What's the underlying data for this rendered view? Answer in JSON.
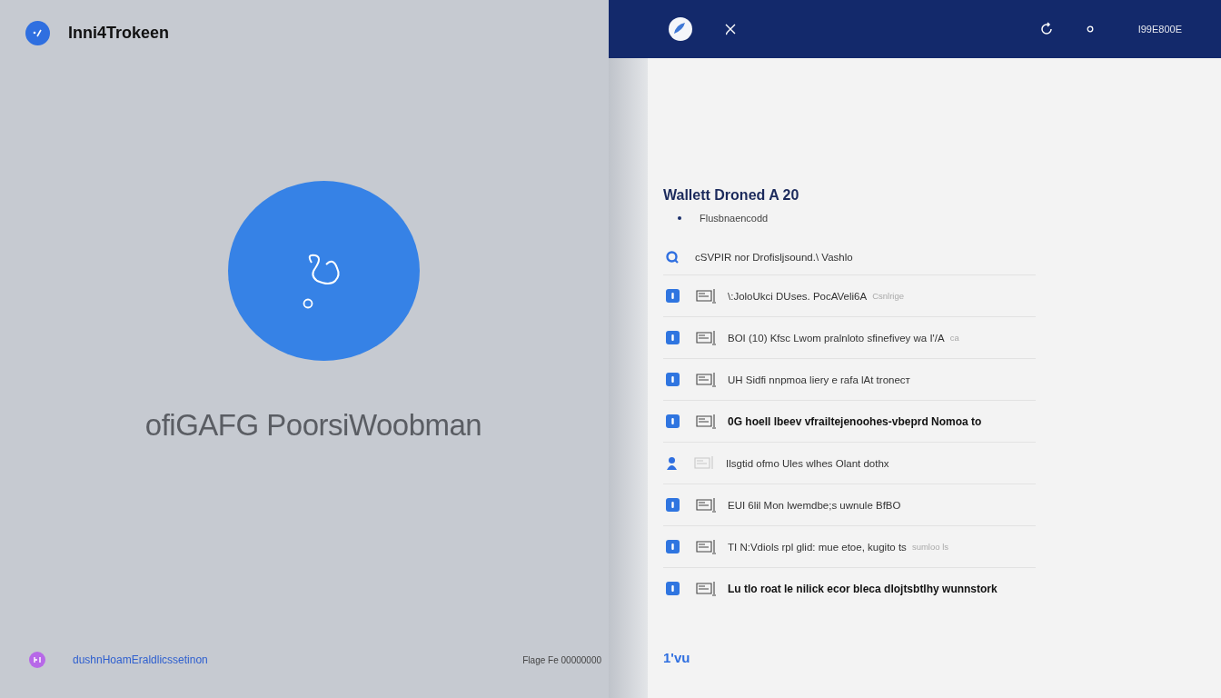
{
  "brand": {
    "name": "Inni4Trokeen"
  },
  "hero": {
    "title": "ofiGAFG PoorsiWoobman"
  },
  "footer": {
    "link": "dushnHoamEraldlicssetinon",
    "note": "Flage Fe 00000000"
  },
  "topbar": {
    "account": "I99E800E"
  },
  "wallet": {
    "title": "Wallett Droned A 20",
    "subtitle": "Flusbnaencodd",
    "corner": "1'vu",
    "items": [
      {
        "kind": "search",
        "text": "cSVPIR nor Drofisljsound.\\ Vashlo",
        "bold": false
      },
      {
        "kind": "square",
        "text": "\\:JoloUkci DUses. PocAVeli6A",
        "extra": "Csnlrige",
        "bold": false
      },
      {
        "kind": "square",
        "text": "BOI (10) Kfsc Lwom pralnloto sfinefivey wa I'/A",
        "extra": "ca",
        "bold": false
      },
      {
        "kind": "square",
        "text": "UH Sidfi nnpmoa liery e rafa lAt troneст",
        "bold": false
      },
      {
        "kind": "square",
        "text": "0G hoell lbeev vfrailtejenoohes-vbeprd Nomoa to",
        "bold": true
      },
      {
        "kind": "faded",
        "text": "Ilsgtid ofmo Ules wlhes Olant dothx",
        "bold": false
      },
      {
        "kind": "square",
        "text": "EUI 6lil Mon lwemdbe;s uwnule BfBO",
        "bold": false
      },
      {
        "kind": "square",
        "text": "TI N:Vdiols rpl glid: mue etoe, kugito ts",
        "extra": "sumloo ls",
        "bold": false
      },
      {
        "kind": "square",
        "text": "Lu tlo roat le nilick ecor bleca dlojtsbtlhy wunnstork",
        "bold": true
      }
    ]
  }
}
